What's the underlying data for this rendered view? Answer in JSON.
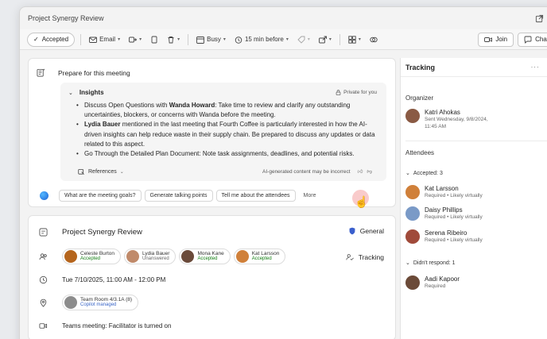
{
  "window": {
    "title": "Project Synergy Review",
    "popout_icon": "popout-icon"
  },
  "toolbar": {
    "accepted": "Accepted",
    "email": "Email",
    "busy": "Busy",
    "reminder": "15 min before",
    "join": "Join",
    "chat": "Chat"
  },
  "prepare": {
    "label": "Prepare for this meeting"
  },
  "insights": {
    "heading": "Insights",
    "private": "Private for you",
    "bullets": [
      {
        "pre": "Discuss Open Questions with ",
        "bold": "Wanda Howard",
        "post": ": Take time to review and clarify any outstanding uncertainties, blockers, or concerns with Wanda before the meeting."
      },
      {
        "pre": "",
        "bold": "Lydia Bauer",
        "post": " mentioned in the last meeting that Fourth Coffee is particularly interested in how the AI-driven insights can help reduce waste in their supply chain. Be prepared to discuss any updates or data related to this aspect."
      },
      {
        "pre": "Go Through the Detailed Plan Document: Note task assignments, deadlines, and potential risks.",
        "bold": "",
        "post": ""
      }
    ],
    "references": "References",
    "ai_note": "AI-generated content may be incorrect"
  },
  "suggestions": [
    "What are the meeting goals?",
    "Generate talking points",
    "Tell me about the attendees",
    "More"
  ],
  "meeting": {
    "title": "Project Synergy Review",
    "channel": "General",
    "tracking": "Tracking",
    "attendees": [
      {
        "name": "Celeste Burton",
        "status": "Accepted",
        "color": "#b5651d"
      },
      {
        "name": "Lydia Bauer",
        "status": "Unanswered",
        "color": "#c08a6a"
      },
      {
        "name": "Mona Kane",
        "status": "Accepted",
        "color": "#6a4a3a"
      },
      {
        "name": "Kat Larsson",
        "status": "Accepted",
        "color": "#d0803a"
      }
    ],
    "datetime": "Tue 7/10/2025, 11:00 AM - 12:00 PM",
    "room": {
      "name": "Team Room 4/3.1A (8)",
      "sub": "Copilot managed"
    },
    "teams": "Teams meeting: Facilitator is turned on"
  },
  "tracking": {
    "title": "Tracking",
    "organizer_label": "Organizer",
    "organizer": {
      "name": "Katri Ahokas",
      "sent": "Sent Wednesday, 9/8/2024,",
      "time": "11:45 AM",
      "color": "#8a5a44"
    },
    "attendees_label": "Attendees",
    "accepted_label": "Accepted: 3",
    "accepted": [
      {
        "name": "Kat Larsson",
        "sub": "Required • Likely virtually",
        "color": "#d0803a"
      },
      {
        "name": "Daisy Phillips",
        "sub": "Required • Likely virtually",
        "color": "#7a9ac7"
      },
      {
        "name": "Serena Ribeiro",
        "sub": "Required • Likely virtually",
        "color": "#a04a3a"
      }
    ],
    "noresp_label": "Didn't respond: 1",
    "noresp": [
      {
        "name": "Aadi Kapoor",
        "sub": "Required",
        "color": "#6b4a38"
      }
    ]
  }
}
